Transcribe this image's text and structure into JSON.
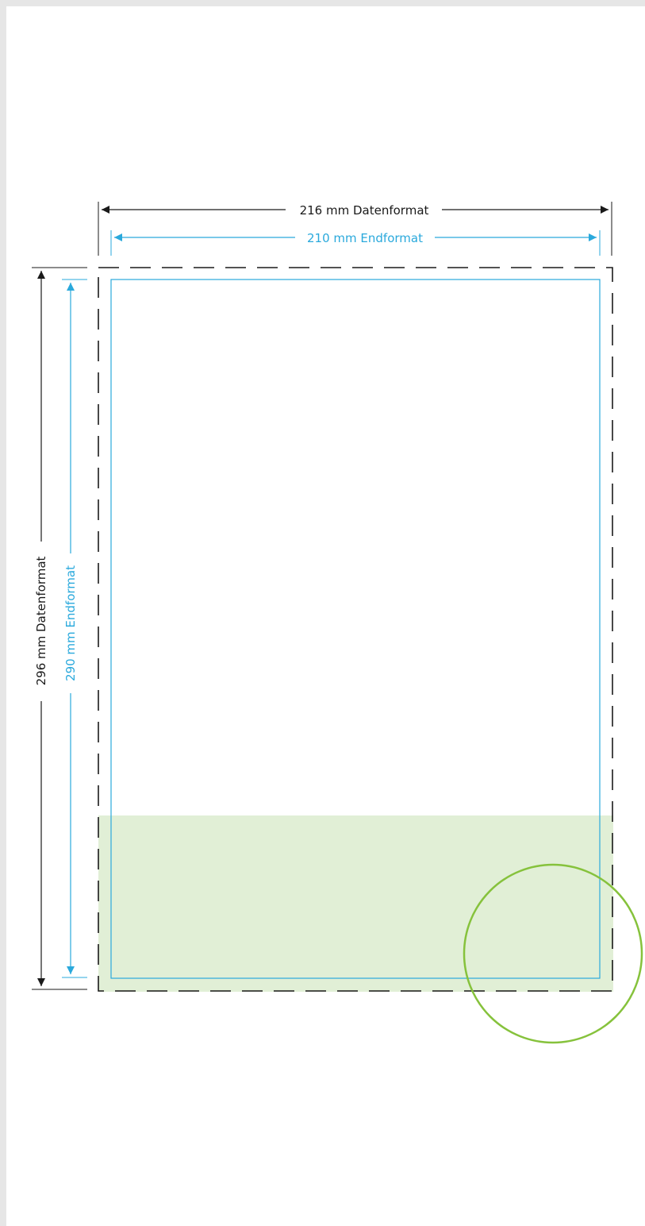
{
  "width_label": {
    "data_format": "216 mm Datenformat",
    "end_format": "210 mm Endformat"
  },
  "height_label": {
    "data_format": "296 mm Datenformat",
    "end_format": "290 mm Endformat"
  },
  "colors": {
    "frame_edge": "#e6e6e6",
    "data_format_line": "#1a1a1a",
    "end_format_line": "#2aa9dc",
    "highlight_fill": "#e1efd6",
    "magnifier_circle": "#86c23c"
  },
  "markers": {
    "dimension_arrow": "arrow-icon",
    "zoom_circle": "magnifier-circle-icon"
  }
}
